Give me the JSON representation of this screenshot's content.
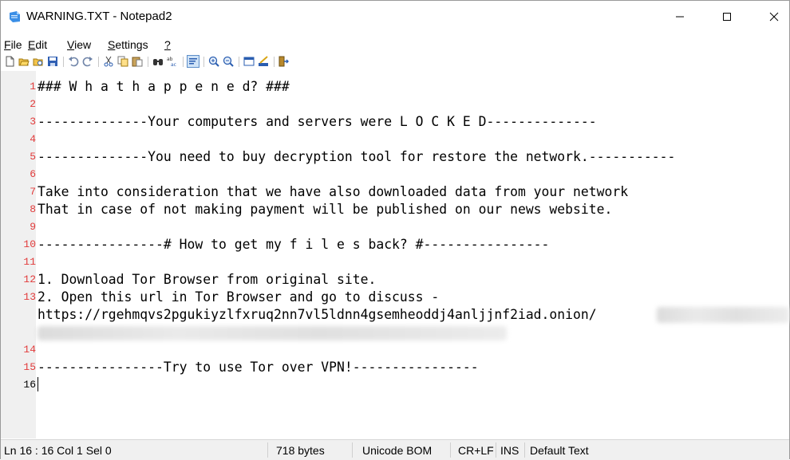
{
  "window": {
    "title": "WARNING.TXT - Notepad2",
    "app_icon": "notepad2-icon",
    "controls": [
      "minimize-icon",
      "maximize-icon",
      "close-icon"
    ]
  },
  "menu": [
    {
      "label": "File",
      "key": "F",
      "rest": "ile"
    },
    {
      "label": "Edit",
      "key": "E",
      "rest": "dit"
    },
    {
      "label": "View",
      "key": "V",
      "rest": "iew"
    },
    {
      "label": "Settings",
      "key": "S",
      "rest": "ettings"
    },
    {
      "label": "?",
      "key": "?",
      "rest": ""
    }
  ],
  "toolbar": [
    "new-file-icon",
    "open-file-icon",
    "browse-icon",
    "save-icon",
    "undo-icon",
    "redo-icon",
    "cut-icon",
    "copy-icon",
    "paste-icon",
    "find-icon",
    "replace-icon",
    "word-wrap-icon",
    "zoom-in-icon",
    "zoom-out-icon",
    "scheme-icon",
    "customize-icon",
    "exit-icon"
  ],
  "editor": {
    "lines": [
      {
        "n": "1",
        "text": "### W h a t h a p p e n e d? ###"
      },
      {
        "n": "2",
        "text": ""
      },
      {
        "n": "3",
        "text": "--------------Your computers and servers were L O C K E D--------------"
      },
      {
        "n": "4",
        "text": ""
      },
      {
        "n": "5",
        "text": "--------------You need to buy decryption tool for restore the network.-----------"
      },
      {
        "n": "6",
        "text": ""
      },
      {
        "n": "7",
        "text": "Take into consideration that we have also downloaded data from your network"
      },
      {
        "n": "8",
        "text": "That in case of not making payment will be published on our news website."
      },
      {
        "n": "9",
        "text": ""
      },
      {
        "n": "10",
        "text": "----------------# How to get my f i l e s back? #----------------"
      },
      {
        "n": "11",
        "text": ""
      },
      {
        "n": "12",
        "text": "1. Download Tor Browser from original site."
      },
      {
        "n": "13",
        "text": "2. Open this url in Tor Browser and go to discuss -"
      },
      {
        "n": "",
        "text": "https://rgehmqvs2pgukiyzlfxruq2nn7vl5ldnn4gsemheoddj4anljjnf2iad.onion/"
      },
      {
        "n": "",
        "text": ""
      },
      {
        "n": "14",
        "text": ""
      },
      {
        "n": "15",
        "text": "----------------Try to use Tor over VPN!----------------"
      },
      {
        "n": "16",
        "text": ""
      }
    ]
  },
  "status": {
    "position": "Ln 16 : 16   Col 1   Sel 0",
    "size": "718 bytes",
    "encoding": "Unicode BOM",
    "eol": "CR+LF",
    "mode": "INS",
    "scheme": "Default Text"
  },
  "colors": {
    "line_numbers": "#e23b3b",
    "gutter": "#f0f0f0",
    "statusbar": "#f0f0f0"
  }
}
